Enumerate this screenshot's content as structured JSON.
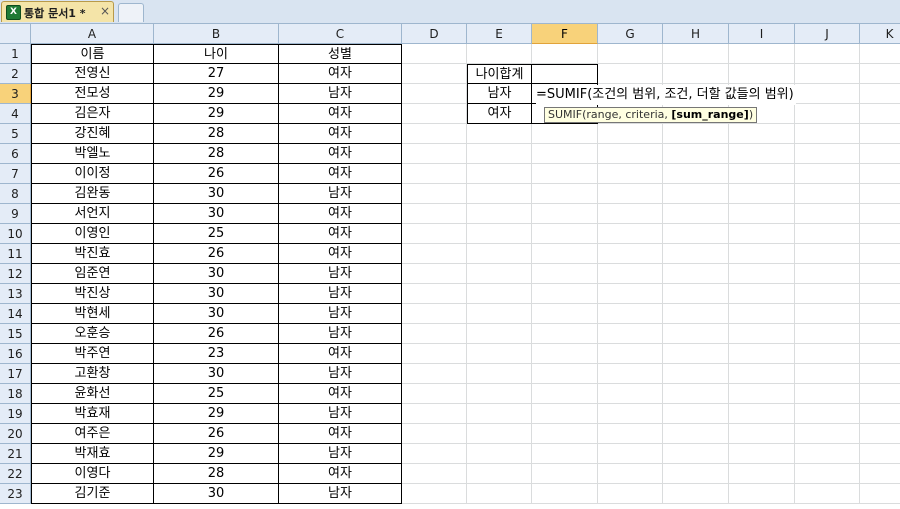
{
  "tab": {
    "label": "통합 문서1 *",
    "close": "×",
    "icon": "excel-icon"
  },
  "columns": [
    "A",
    "B",
    "C",
    "D",
    "E",
    "F",
    "G",
    "H",
    "I",
    "J",
    "K"
  ],
  "selected_column": "F",
  "rows": [
    "1",
    "2",
    "3",
    "4",
    "5",
    "6",
    "7",
    "8",
    "9",
    "10",
    "11",
    "12",
    "13",
    "14",
    "15",
    "16",
    "17",
    "18",
    "19",
    "20",
    "21",
    "22",
    "23"
  ],
  "selected_row": "3",
  "table": {
    "headers": [
      "이름",
      "나이",
      "성별"
    ],
    "records": [
      [
        "전영신",
        "27",
        "여자"
      ],
      [
        "전모성",
        "29",
        "남자"
      ],
      [
        "김은자",
        "29",
        "여자"
      ],
      [
        "강진혜",
        "28",
        "여자"
      ],
      [
        "박엘노",
        "28",
        "여자"
      ],
      [
        "이이정",
        "26",
        "여자"
      ],
      [
        "김완동",
        "30",
        "남자"
      ],
      [
        "서언지",
        "30",
        "여자"
      ],
      [
        "이영인",
        "25",
        "여자"
      ],
      [
        "박진효",
        "26",
        "여자"
      ],
      [
        "임준연",
        "30",
        "남자"
      ],
      [
        "박진상",
        "30",
        "남자"
      ],
      [
        "박현세",
        "30",
        "남자"
      ],
      [
        "오훈승",
        "26",
        "남자"
      ],
      [
        "박주연",
        "23",
        "여자"
      ],
      [
        "고환창",
        "30",
        "남자"
      ],
      [
        "윤화선",
        "25",
        "여자"
      ],
      [
        "박효재",
        "29",
        "남자"
      ],
      [
        "여주은",
        "26",
        "여자"
      ],
      [
        "박재효",
        "29",
        "남자"
      ],
      [
        "이영다",
        "28",
        "여자"
      ],
      [
        "김기준",
        "30",
        "남자"
      ]
    ]
  },
  "summary": {
    "header": "나이합계",
    "male": "남자",
    "female": "여자",
    "formula": "=SUMIF(조건의 범위, 조건, 더할 값들의 범위)",
    "tooltip_fn": "SUMIF(range, criteria, ",
    "tooltip_bold": "[sum_range]",
    "tooltip_end": ")"
  }
}
